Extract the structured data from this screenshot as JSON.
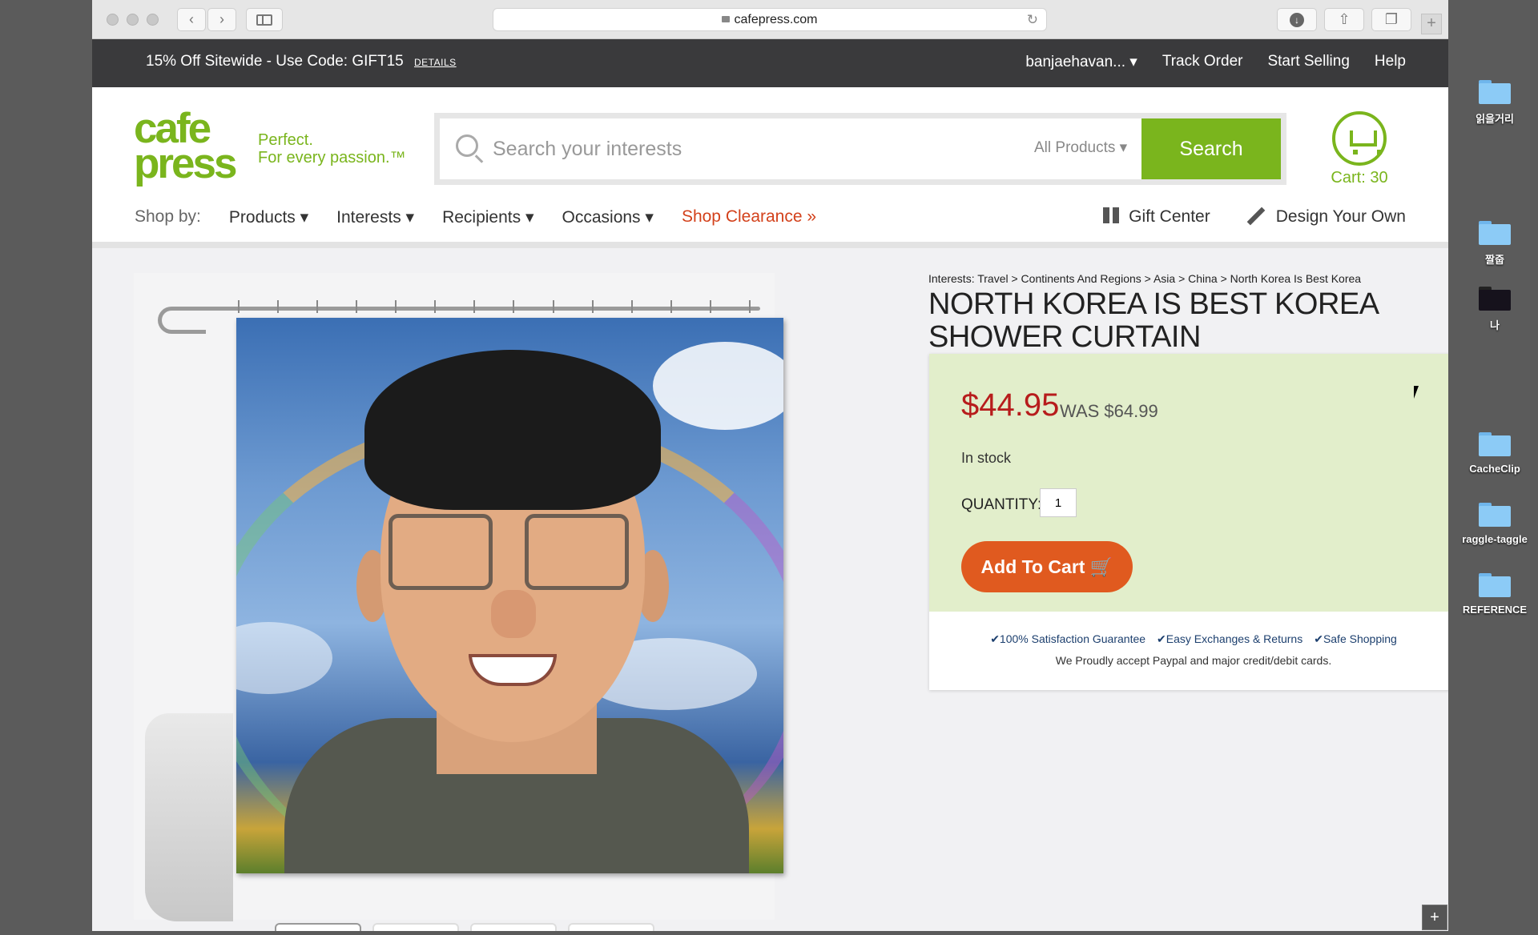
{
  "browser": {
    "url": "cafepress.com"
  },
  "promo": {
    "offer": "15% Off Sitewide - Use Code: GIFT15",
    "details": "DETAILS",
    "account": "banjaehavan... ▾",
    "track_order": "Track Order",
    "start_selling": "Start Selling",
    "help": "Help"
  },
  "header": {
    "logo_top": "cafe",
    "logo_bottom": "press",
    "tagline_1": "Perfect.",
    "tagline_2": "For every passion.™",
    "search_placeholder": "Search your interests",
    "products_select": "All Products ▾",
    "search_button": "Search",
    "cart": "Cart: 30"
  },
  "nav": {
    "shop_by": "Shop by:",
    "items": [
      "Products ▾",
      "Interests ▾",
      "Recipients ▾",
      "Occasions ▾"
    ],
    "clearance": "Shop Clearance »",
    "gift_center": "Gift Center",
    "design_your_own": "Design Your Own"
  },
  "product": {
    "breadcrumb": "Interests: Travel > Continents And Regions > Asia > China > North Korea Is Best Korea",
    "title": "NORTH KOREA IS BEST KOREA SHOWER CURTAIN",
    "price": "$44.95",
    "was_price": "WAS $64.99",
    "stock": "In stock",
    "quantity_label": "QUANTITY:",
    "quantity": "1",
    "add_to_cart": "Add To Cart 🛒",
    "guarantees": [
      "100% Satisfaction Guarantee",
      "Easy Exchanges & Returns",
      "Safe Shopping"
    ],
    "accept": "We Proudly accept Paypal and major credit/debit cards."
  },
  "desktop": {
    "icons": [
      "읽을거리",
      "짤줍",
      "나",
      "CacheClip",
      "raggle-taggle",
      "REFERENCE"
    ]
  },
  "colors": {
    "brand_green": "#7ab51d",
    "price_red": "#b71c1c",
    "cta_orange": "#e05a1f",
    "clearance_red": "#d3411b"
  }
}
